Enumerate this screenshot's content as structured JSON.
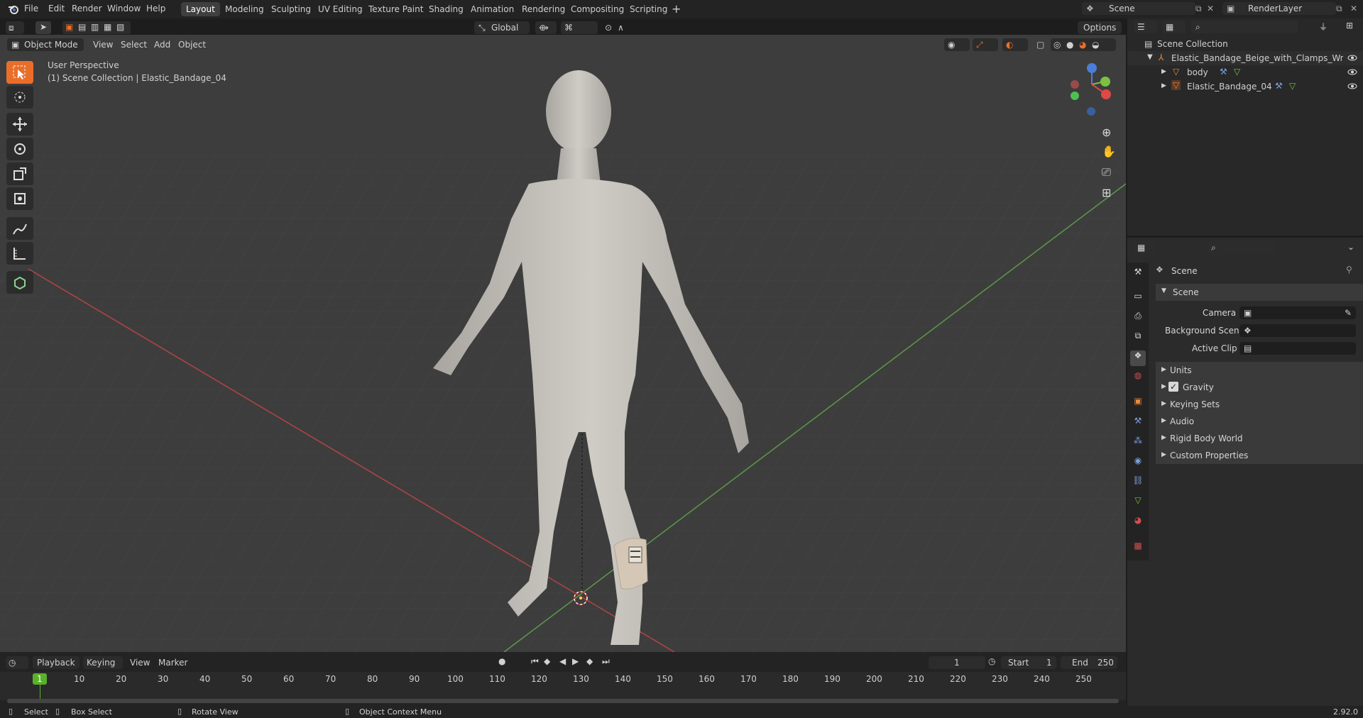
{
  "menubar": {
    "items": [
      "File",
      "Edit",
      "Render",
      "Window",
      "Help"
    ],
    "workspaces": [
      "Layout",
      "Modeling",
      "Sculpting",
      "UV Editing",
      "Texture Paint",
      "Shading",
      "Animation",
      "Rendering",
      "Compositing",
      "Scripting"
    ],
    "active_workspace": "Layout",
    "scene_name": "Scene",
    "render_layer": "RenderLayer"
  },
  "viewport_header": {
    "mode": "Object Mode",
    "menus": [
      "View",
      "Select",
      "Add",
      "Object"
    ],
    "transform_orientation": "Global",
    "options_label": "Options"
  },
  "viewport": {
    "perspective_label": "User Perspective",
    "collection_label": "(1) Scene Collection | Elastic_Bandage_04"
  },
  "outliner": {
    "root": "Scene Collection",
    "items": [
      {
        "label": "Elastic_Bandage_Beige_with_Clamps_Wrapp",
        "level": 1
      },
      {
        "label": "body",
        "level": 2
      },
      {
        "label": "Elastic_Bandage_04",
        "level": 2
      }
    ]
  },
  "properties": {
    "context_title": "Scene",
    "panel_title": "Scene",
    "fields": [
      {
        "label": "Camera"
      },
      {
        "label": "Background Scene"
      },
      {
        "label": "Active Clip"
      }
    ],
    "subpanels": [
      "Units",
      "Gravity",
      "Keying Sets",
      "Audio",
      "Rigid Body World",
      "Custom Properties"
    ],
    "gravity_checked": true
  },
  "timeline": {
    "menus": [
      "Playback",
      "Keying",
      "View",
      "Marker"
    ],
    "current_frame": "1",
    "start_label": "Start",
    "start_value": "1",
    "end_label": "End",
    "end_value": "250",
    "ticks": [
      "1",
      "10",
      "20",
      "30",
      "40",
      "50",
      "60",
      "70",
      "80",
      "90",
      "100",
      "110",
      "120",
      "130",
      "140",
      "150",
      "160",
      "170",
      "180",
      "190",
      "200",
      "210",
      "220",
      "230",
      "240",
      "250"
    ]
  },
  "statusbar": {
    "select": "Select",
    "box_select": "Box Select",
    "rotate_view": "Rotate View",
    "context_menu": "Object Context Menu",
    "version": "2.92.0"
  },
  "colors": {
    "accent": "#ea6e2a",
    "viewport_bg": "#3d3d3d",
    "x_axis": "#b34444",
    "y_axis": "#5a9a4a",
    "panel_bg": "#2b2b2b"
  }
}
